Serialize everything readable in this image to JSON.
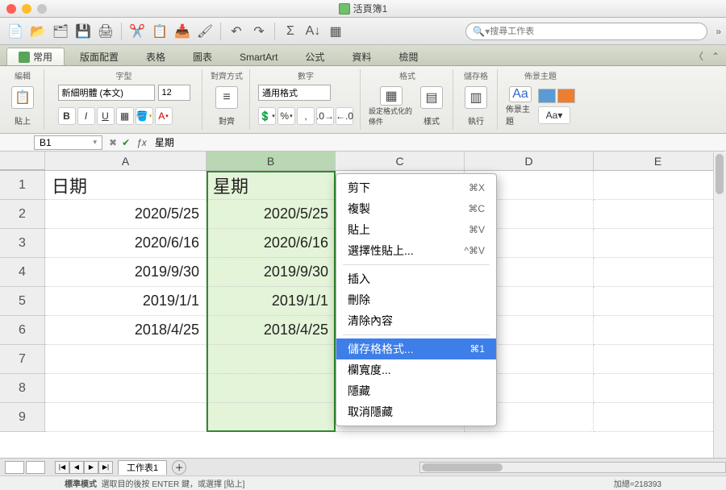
{
  "window": {
    "title": "活頁簿1"
  },
  "search": {
    "placeholder": "搜尋工作表"
  },
  "tabs": {
    "home": "常用",
    "layout": "版面配置",
    "tables": "表格",
    "charts": "圖表",
    "smartart": "SmartArt",
    "formulas": "公式",
    "data": "資料",
    "review": "檢閱"
  },
  "ribbon": {
    "edit": {
      "label": "編輯",
      "paste": "貼上"
    },
    "font": {
      "label": "字型",
      "name": "新細明體 (本文)",
      "size": "12",
      "bold": "B",
      "italic": "I",
      "underline": "U"
    },
    "align": {
      "label": "對齊方式",
      "btn": "對齊"
    },
    "number": {
      "label": "數字",
      "format": "通用格式"
    },
    "format_group": {
      "label": "格式",
      "cond": "設定格式化的條件",
      "styles": "樣式"
    },
    "cells": {
      "label": "儲存格",
      "action": "執行"
    },
    "themes": {
      "label": "佈景主題",
      "btn": "佈景主題",
      "aa": "Aa▾"
    }
  },
  "namebox": "B1",
  "formula": "星期",
  "columns": [
    "A",
    "B",
    "C",
    "D",
    "E"
  ],
  "rows": [
    "1",
    "2",
    "3",
    "4",
    "5",
    "6",
    "7",
    "8",
    "9"
  ],
  "cells": {
    "A1": "日期",
    "B1": "星期",
    "A2": "2020/5/25",
    "B2": "2020/5/25",
    "A3": "2020/6/16",
    "B3": "2020/6/16",
    "A4": "2019/9/30",
    "B4": "2019/9/30",
    "A5": "2019/1/1",
    "B5": "2019/1/1",
    "A6": "2018/4/25",
    "B6": "2018/4/25"
  },
  "context_menu": {
    "cut": {
      "label": "剪下",
      "sc": "⌘X"
    },
    "copy": {
      "label": "複製",
      "sc": "⌘C"
    },
    "paste": {
      "label": "貼上",
      "sc": "⌘V"
    },
    "paste_special": {
      "label": "選擇性貼上...",
      "sc": "^⌘V"
    },
    "insert": {
      "label": "插入"
    },
    "delete": {
      "label": "刪除"
    },
    "clear": {
      "label": "清除內容"
    },
    "format_cells": {
      "label": "儲存格格式...",
      "sc": "⌘1"
    },
    "col_width": {
      "label": "欄寬度..."
    },
    "hide": {
      "label": "隱藏"
    },
    "unhide": {
      "label": "取消隱藏"
    }
  },
  "sheet_tab": "工作表1",
  "status": {
    "mode": "標準模式",
    "hint": "選取目的後按 ENTER 鍵，或選擇 [貼上]",
    "sum": "加總=218393"
  }
}
